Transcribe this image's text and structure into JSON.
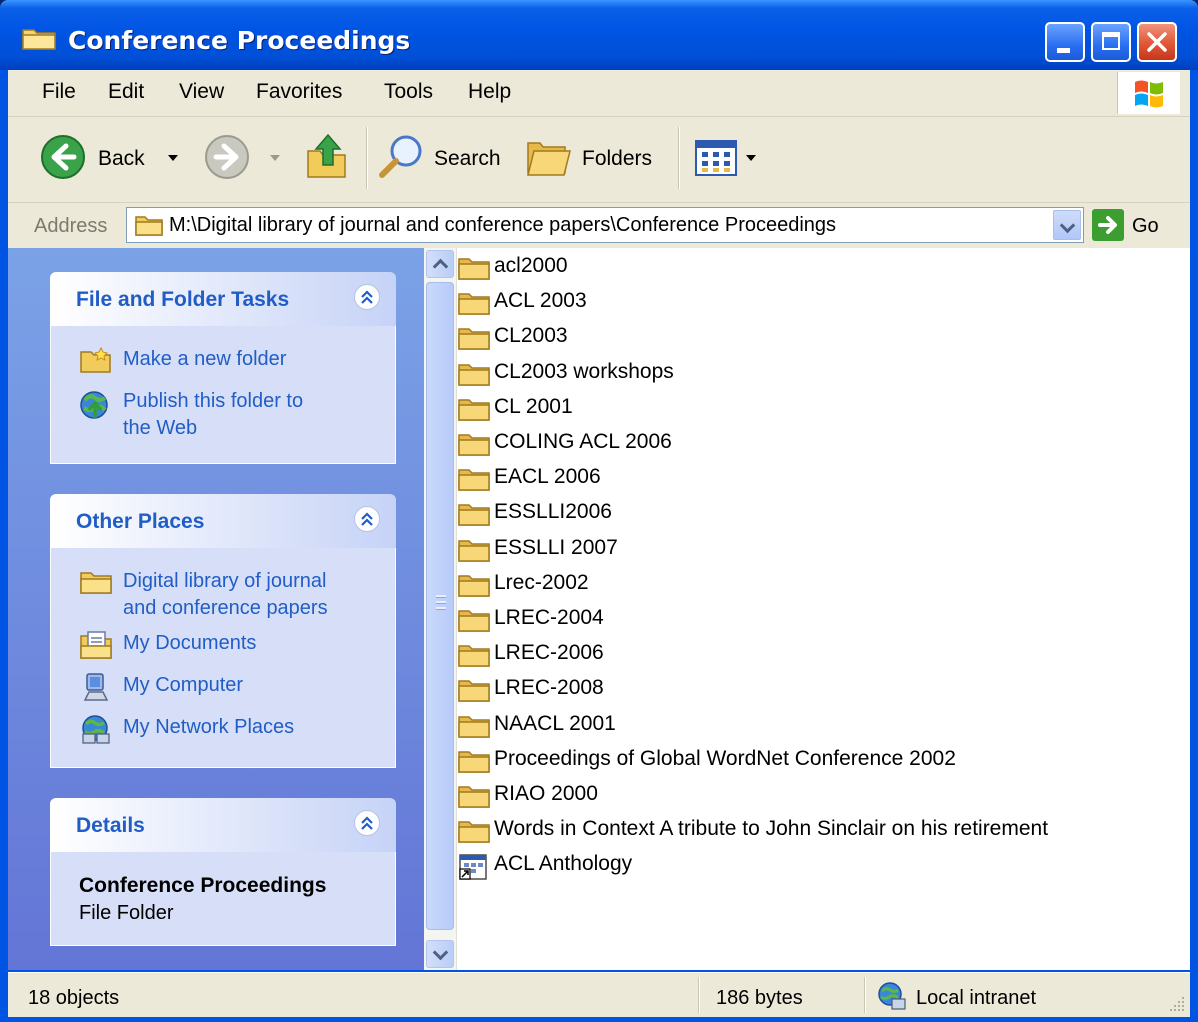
{
  "window": {
    "title": "Conference Proceedings"
  },
  "menu": {
    "items": [
      "File",
      "Edit",
      "View",
      "Favorites",
      "Tools",
      "Help"
    ]
  },
  "toolbar": {
    "back_label": "Back",
    "search_label": "Search",
    "folders_label": "Folders"
  },
  "address": {
    "label": "Address",
    "path": "M:\\Digital library of journal and conference papers\\Conference Proceedings",
    "go_label": "Go"
  },
  "taskpane": {
    "file_tasks": {
      "title": "File and Folder Tasks",
      "items": [
        "Make a new folder",
        "Publish this folder to",
        "the Web"
      ]
    },
    "other_places": {
      "title": "Other Places",
      "items": [
        "Digital library of journal",
        "and conference papers",
        "My Documents",
        "My Computer",
        "My Network Places"
      ]
    },
    "details": {
      "title": "Details",
      "name": "Conference Proceedings",
      "type": "File Folder"
    }
  },
  "files": [
    "acl2000",
    "ACL 2003",
    "CL2003",
    "CL2003 workshops",
    "CL 2001",
    "COLING ACL 2006",
    "EACL 2006",
    "ESSLLI2006",
    "ESSLLI 2007",
    "Lrec-2002",
    "LREC-2004",
    "LREC-2006",
    "LREC-2008",
    "NAACL 2001",
    "Proceedings of Global WordNet Conference 2002",
    "RIAO 2000",
    "Words in Context A tribute to John Sinclair on his retirement",
    "ACL Anthology"
  ],
  "status": {
    "objects": "18 objects",
    "size": "186 bytes",
    "zone": "Local intranet"
  },
  "colors": {
    "titlebar": "#0054e3",
    "chrome": "#ece9d8",
    "task_link": "#215dc6",
    "folder": "#f2cc5a"
  }
}
